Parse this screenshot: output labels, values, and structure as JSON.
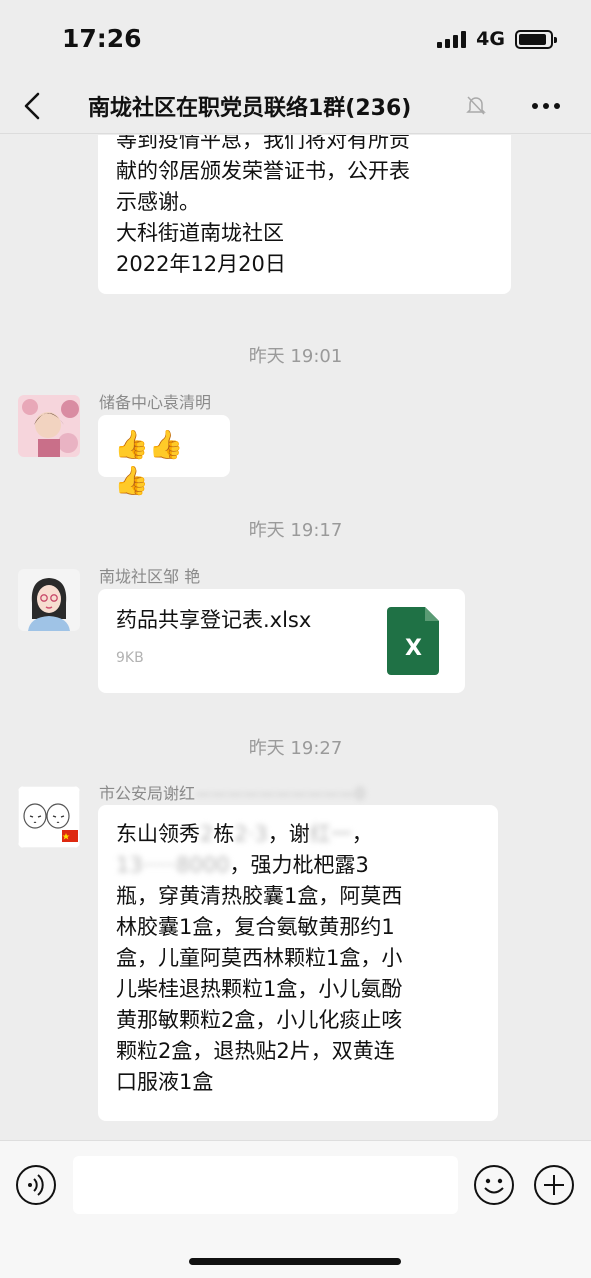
{
  "status_bar": {
    "time": "17:26",
    "network": "4G"
  },
  "header": {
    "title": "南垅社区在职党员联络1群(236)"
  },
  "messages": [
    {
      "text": "等到疫情平息，我们将对有所贡\n献的邻居颁发荣誉证书，公开表\n示感谢。\n大科街道南垅社区\n2022年12月20日"
    },
    {
      "timestamp": "昨天 19:01"
    },
    {
      "sender": "储备中心袁清明",
      "text": "👍👍👍"
    },
    {
      "timestamp": "昨天 19:17"
    },
    {
      "sender": "南垅社区邹 艳",
      "file_name": "药品共享登记表.xlsx",
      "file_size": "9KB",
      "file_icon": "X"
    },
    {
      "timestamp": "昨天 19:27"
    },
    {
      "sender": "市公安局谢红",
      "sender_blurred": "——————————0",
      "line1_a": "东山领秀",
      "line1_blur1": "2",
      "line1_b": "栋",
      "line1_blur2": "2·3",
      "line1_c": "，谢",
      "line1_blur3": "红一",
      "line1_d": "，",
      "line2_blur": "13·····8000",
      "line2_c": "，强力枇杷露3",
      "rest": "瓶，穿黄清热胶囊1盒，阿莫西\n林胶囊1盒，复合氨敏黄那约1\n盒，儿童阿莫西林颗粒1盒，小\n儿柴桂退热颗粒1盒，小儿氨酚\n黄那敏颗粒2盒，小儿化痰止咳\n颗粒2盒，退热贴2片，双黄连\n口服液1盒"
    }
  ],
  "input": {
    "placeholder": ""
  },
  "colors": {
    "background": "#ededed",
    "bubble": "#ffffff",
    "excel": "#1f7145",
    "timestamp": "#9a9a9a"
  }
}
